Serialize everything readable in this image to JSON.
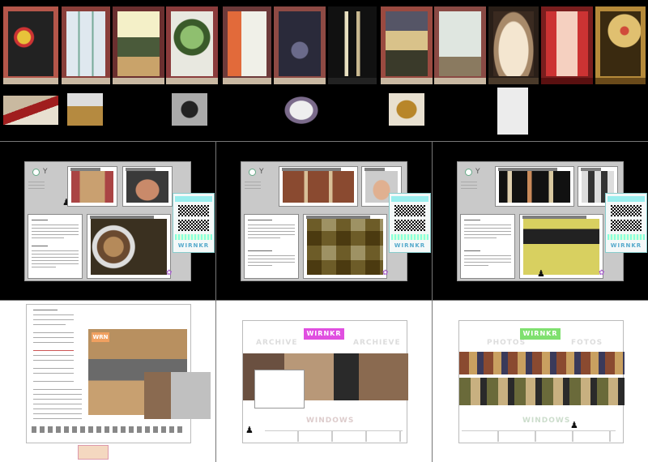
{
  "colors": {
    "background": "#000000",
    "panel_light": "#ffffff",
    "app_gray": "#c9c9c9",
    "brand_orange": "#f0a060",
    "brand_magenta": "#e04fe0",
    "brand_green": "#7fe06f",
    "ticker_teal": "#5ac"
  },
  "strip": {
    "windows": [
      {
        "icon": "shop-window-photo-1"
      },
      {
        "icon": "shop-window-photo-2"
      },
      {
        "icon": "shop-window-photo-3"
      },
      {
        "icon": "shop-window-photo-4"
      },
      {
        "icon": "shop-window-photo-5"
      },
      {
        "icon": "shop-window-photo-6"
      },
      {
        "icon": "shop-window-photo-7"
      },
      {
        "icon": "shop-window-photo-8"
      },
      {
        "icon": "shop-window-photo-9"
      },
      {
        "icon": "shop-window-photo-10"
      },
      {
        "icon": "shop-window-photo-11"
      },
      {
        "icon": "shop-window-photo-12"
      }
    ],
    "thumbnails": [
      {
        "icon": "object-photo-1"
      },
      {
        "icon": "object-photo-2"
      },
      {
        "icon": "object-photo-3"
      },
      {
        "icon": "object-photo-4"
      },
      {
        "icon": "object-photo-5"
      },
      {
        "icon": "object-photo-6"
      }
    ]
  },
  "middle_panels": [
    {
      "ticker_word": "WIRNKR"
    },
    {
      "ticker_word": "WIRNKR"
    },
    {
      "ticker_word": "WIRNKR"
    }
  ],
  "bottom_panels": {
    "left": {
      "badge": "WRN"
    },
    "center": {
      "title": "WIRNKR",
      "ghost_left": "ARCHIVE",
      "ghost_right": "ARCHIEVE",
      "footer": "WINDOWS"
    },
    "right": {
      "title": "WIRNKR",
      "ghost_left": "PHOTOS",
      "ghost_right": "FOTOS",
      "footer": "WINDOWS"
    }
  }
}
